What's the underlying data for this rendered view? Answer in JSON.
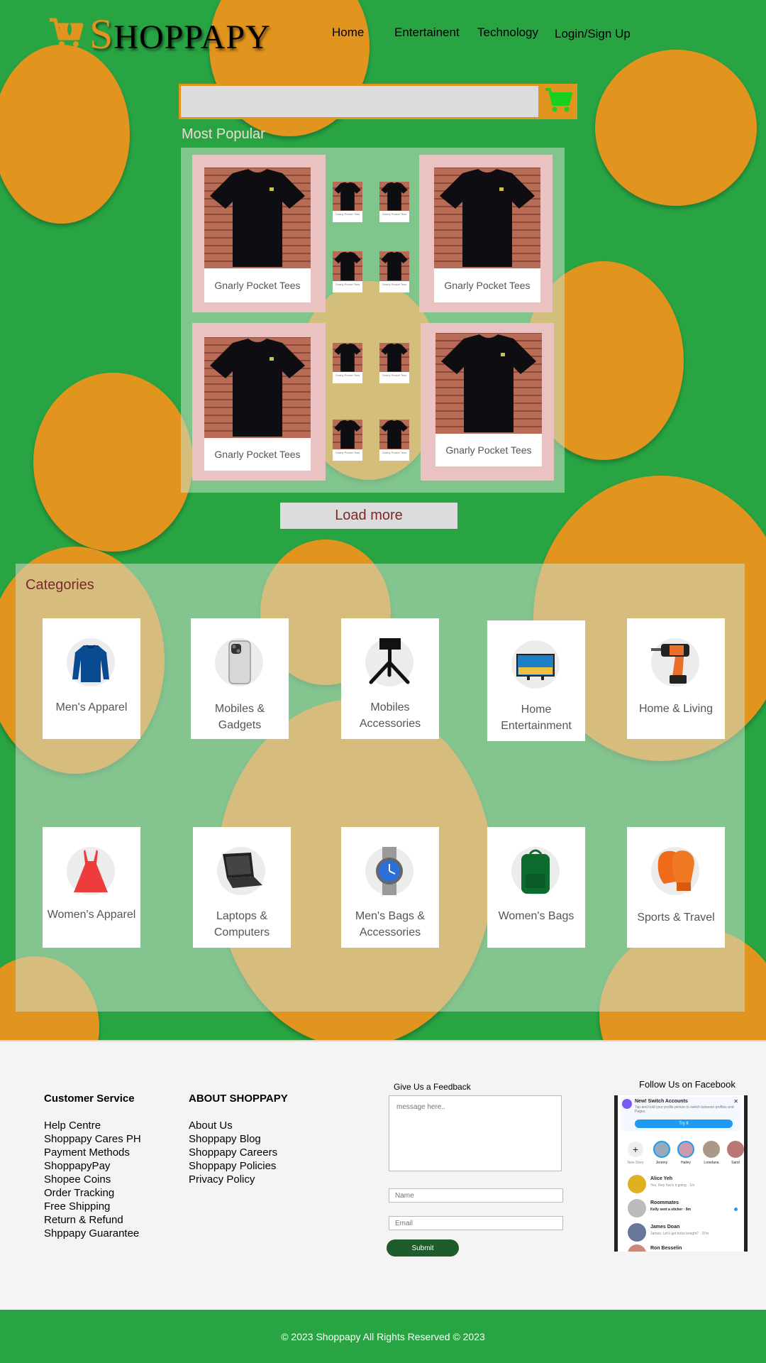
{
  "brand": {
    "first_letter": "S",
    "rest": "HOPPAPY"
  },
  "nav": {
    "home": "Home",
    "entertainment": "Entertainent",
    "technology": "Technology",
    "login": "Login/Sign Up"
  },
  "search": {
    "placeholder": ""
  },
  "popular": {
    "title": "Most Popular",
    "items": [
      "Gnarly Pocket Tees",
      "Gnarly Pocket Tees",
      "Gnarly Pocket Tees",
      "Gnarly Pocket Tees"
    ],
    "thumb_label": "Gnarly Pocket Tees"
  },
  "load_more": "Load more",
  "categories": {
    "title": "Categories",
    "items": [
      {
        "name": "Men's Apparel",
        "icon": "sweater-icon"
      },
      {
        "name": "Mobiles & Gadgets",
        "icon": "smartphone-icon"
      },
      {
        "name": "Mobiles Accessories",
        "icon": "tripod-icon"
      },
      {
        "name": "Home Entertainment",
        "icon": "tv-icon"
      },
      {
        "name": "Home & Living",
        "icon": "drill-icon"
      },
      {
        "name": "Women's Apparel",
        "icon": "dress-icon"
      },
      {
        "name": "Laptops & Computers",
        "icon": "laptop-icon"
      },
      {
        "name": "Men's Bags & Accessories",
        "icon": "watch-icon"
      },
      {
        "name": "Women's Bags",
        "icon": "backpack-icon"
      },
      {
        "name": "Sports & Travel",
        "icon": "boxing-glove-icon"
      }
    ]
  },
  "footer": {
    "customer_service": {
      "title": "Customer Service",
      "links": [
        "Help Centre",
        "Shoppapy Cares PH",
        "Payment Methods",
        "ShoppapyPay",
        "Shopee Coins",
        "Order Tracking",
        "Free Shipping",
        "Return & Refund",
        "Shppapy Guarantee"
      ]
    },
    "about": {
      "title": "ABOUT SHOPPAPY",
      "links": [
        "About Us",
        "Shoppapy Blog",
        "Shoppapy Careers",
        "Shoppapy Policies",
        "Privacy Policy"
      ]
    },
    "feedback": {
      "title": "Give Us a Feedback",
      "message_placeholder": "message here..",
      "name_placeholder": "Name",
      "email_placeholder": "Email",
      "submit": "Submit"
    },
    "facebook": {
      "title": "Follow Us on Facebook",
      "banner_title": "New! Switch Accounts",
      "banner_text": "Tap and hold your profile picture to switch between profiles and Pages.",
      "banner_button": "Try It",
      "story_new": "New Story",
      "stories": [
        "Jeremy",
        "Hailey",
        "Loredana",
        "Sand"
      ],
      "chats": [
        {
          "name": "Alice Yeh",
          "msg": "Yes, they hav's it going · 1m"
        },
        {
          "name": "Roommates",
          "msg": "Kelly sent a sticker · 9m"
        },
        {
          "name": "James Doan",
          "msg": "James: Let's get boba tonight? · 37m"
        },
        {
          "name": "Ron Besselin",
          "msg": ""
        }
      ]
    },
    "copyright": "© 2023 Shoppapy All Rights Reserved © 2023"
  },
  "colors": {
    "green": "#28a443",
    "orange": "#e1941e",
    "dark_green": "#1e5c2c"
  }
}
